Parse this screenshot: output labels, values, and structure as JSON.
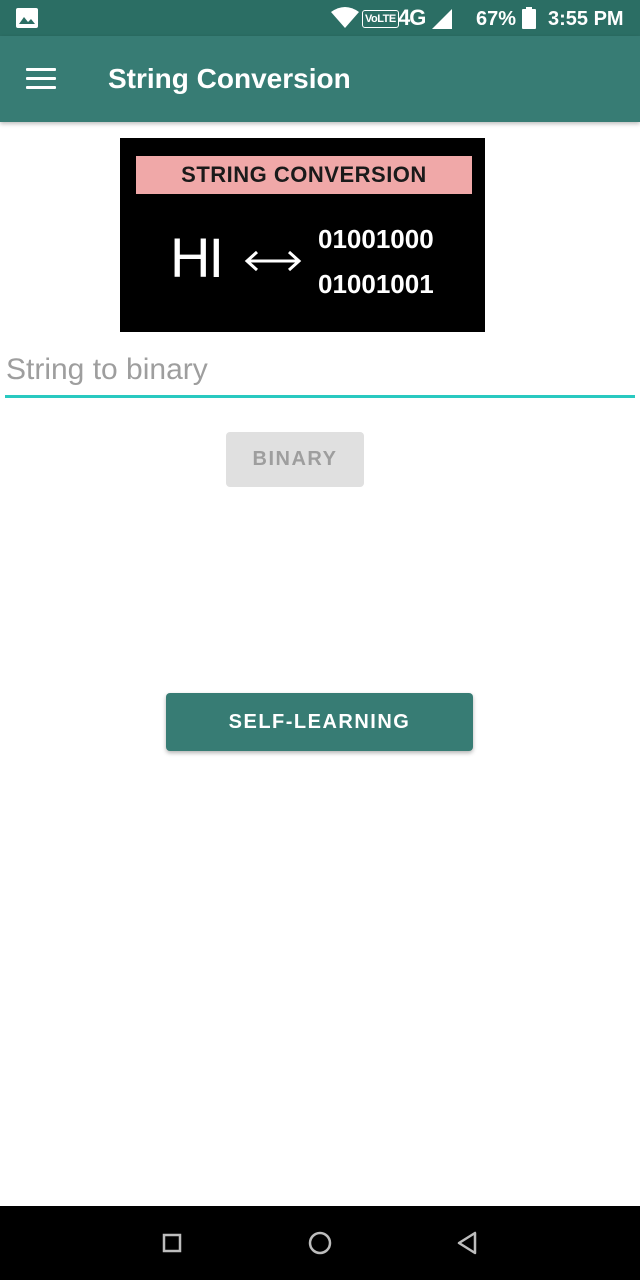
{
  "status_bar": {
    "network_badge": "VoLTE",
    "network_type": "4G",
    "battery_percent": "67%",
    "time": "3:55 PM"
  },
  "toolbar": {
    "title": "String Conversion"
  },
  "banner": {
    "title": "STRING CONVERSION",
    "text": "HI",
    "binary_line_1": "01001000",
    "binary_line_2": "01001001"
  },
  "input": {
    "placeholder": "String to binary",
    "value": ""
  },
  "buttons": {
    "binary": "BINARY",
    "self_learning": "SELF-LEARNING"
  },
  "icons": {
    "status_left": "gallery-icon",
    "wifi": "wifi-icon",
    "signal": "signal-icon",
    "battery": "battery-icon",
    "menu": "menu-icon",
    "arrow": "double-arrow-icon",
    "nav_recent": "square-icon",
    "nav_home": "circle-icon",
    "nav_back": "triangle-back-icon"
  },
  "colors": {
    "status_bar": "#2b6e64",
    "toolbar": "#377c74",
    "accent": "#29c9c0",
    "banner_title_bg": "#f0a8a8",
    "disabled_button": "#e0e0e0"
  }
}
